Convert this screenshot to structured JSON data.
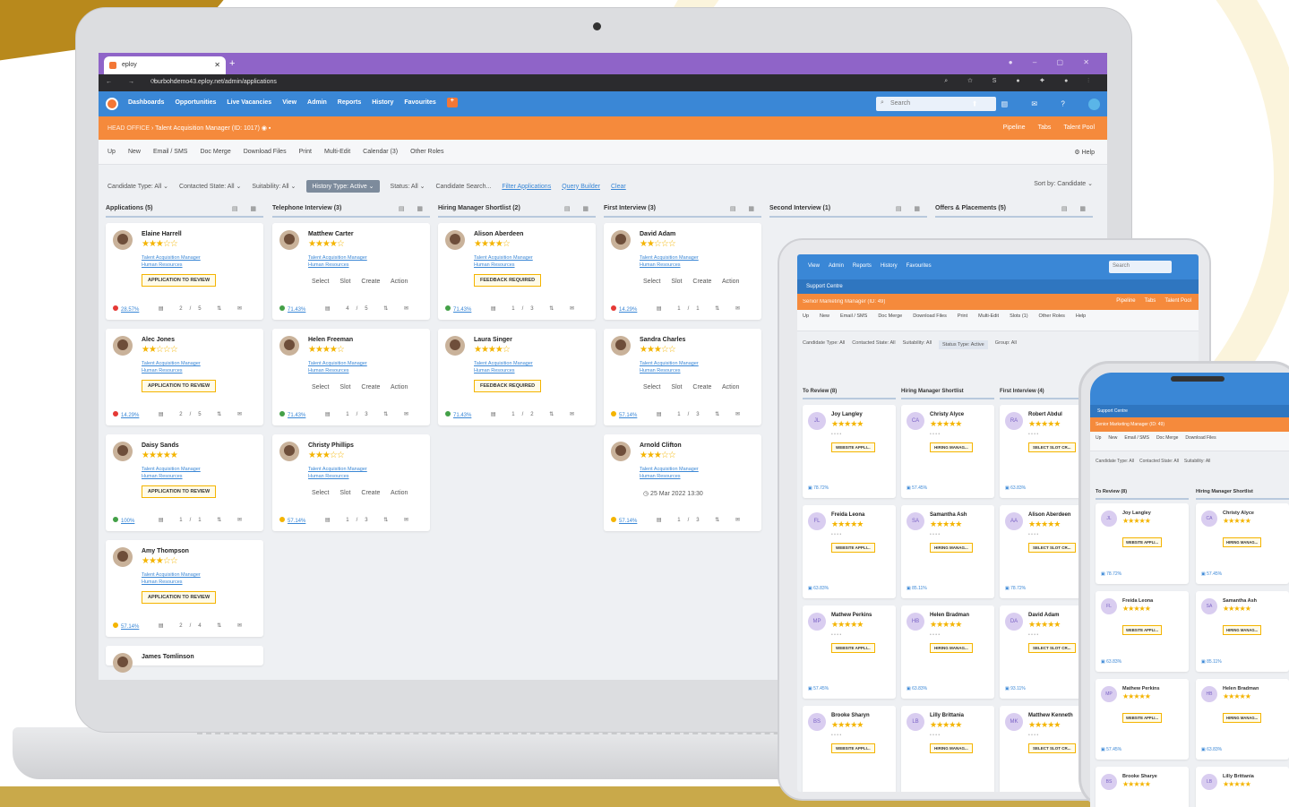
{
  "browser": {
    "tab_title": "eploy",
    "url": "burbohdemo43.eploy.net/admin/applications"
  },
  "nav": {
    "items": [
      "Dashboards",
      "Opportunities",
      "Live Vacancies",
      "View",
      "Admin",
      "Reports",
      "History",
      "Favourites"
    ],
    "search_placeholder": "Search"
  },
  "header": {
    "breadcrumb": "HEAD OFFICE",
    "title": "Talent Acquisition Manager (ID: 1017)",
    "right_items": [
      "Pipeline",
      "Tabs",
      "Talent Pool"
    ]
  },
  "toolbar": {
    "items": [
      "Up",
      "New",
      "Email / SMS",
      "Doc Merge",
      "Download Files",
      "Print",
      "Multi-Edit",
      "Calendar (3)",
      "Other Roles"
    ],
    "help": "Help"
  },
  "filters": {
    "items": [
      "Candidate Type: All",
      "Contacted State: All",
      "Suitability: All"
    ],
    "active": "History Type: Active",
    "status": "Status: All",
    "search_placeholder": "Candidate Search...",
    "links": [
      "Filter Applications",
      "Query Builder",
      "Clear"
    ],
    "sort": "Sort by: Candidate"
  },
  "columns": [
    {
      "title": "Applications (5)",
      "cards": [
        {
          "name": "Elaine Harrell",
          "stars": "★★★☆☆",
          "role": "Talent Acquisition Manager",
          "dept": "Human Resources",
          "action": "APPLICATION TO REVIEW",
          "dot": "#e53935",
          "pct": "28.57%",
          "count": "2/5"
        },
        {
          "name": "Alec Jones",
          "stars": "★★☆☆☆",
          "role": "Talent Acquisition Manager",
          "dept": "Human Resources",
          "action": "APPLICATION TO REVIEW",
          "dot": "#e53935",
          "pct": "14.29%",
          "count": "2/5"
        },
        {
          "name": "Daisy Sands",
          "stars": "★★★★★",
          "role": "Talent Acquisition Manager",
          "dept": "Human Resources",
          "action": "APPLICATION TO REVIEW",
          "dot": "#43a047",
          "pct": "100%",
          "count": "1/1"
        },
        {
          "name": "Amy Thompson",
          "stars": "★★★☆☆",
          "role": "Talent Acquisition Manager",
          "dept": "Human Resources",
          "action": "APPLICATION TO REVIEW",
          "dot": "#f4b400",
          "pct": "57.14%",
          "count": "2/4"
        }
      ],
      "extra": "James Tomlinson"
    },
    {
      "title": "Telephone Interview (3)",
      "cards": [
        {
          "name": "Matthew Carter",
          "stars": "★★★★☆",
          "role": "Talent Acquisition Manager",
          "dept": "Human Resources",
          "slot": "Select Slot   Create Action",
          "dot": "#43a047",
          "pct": "71.43%",
          "count": "4/5"
        },
        {
          "name": "Helen Freeman",
          "stars": "★★★★☆",
          "role": "Talent Acquisition Manager",
          "dept": "Human Resources",
          "slot": "Select Slot   Create Action",
          "dot": "#43a047",
          "pct": "71.43%",
          "count": "1/3"
        },
        {
          "name": "Christy Phillips",
          "stars": "★★★☆☆",
          "role": "Talent Acquisition Manager",
          "dept": "Human Resources",
          "slot": "Select Slot   Create Action",
          "dot": "#f4b400",
          "pct": "57.14%",
          "count": "1/3"
        }
      ]
    },
    {
      "title": "Hiring Manager Shortlist (2)",
      "cards": [
        {
          "name": "Alison Aberdeen",
          "stars": "★★★★☆",
          "role": "Talent Acquisition Manager",
          "dept": "Human Resources",
          "action": "FEEDBACK REQUIRED",
          "dot": "#43a047",
          "pct": "71.43%",
          "count": "1/3"
        },
        {
          "name": "Laura Singer",
          "stars": "★★★★☆",
          "role": "Talent Acquisition Manager",
          "dept": "Human Resources",
          "action": "FEEDBACK REQUIRED",
          "dot": "#43a047",
          "pct": "71.43%",
          "count": "1/2"
        }
      ]
    },
    {
      "title": "First Interview (3)",
      "cards": [
        {
          "name": "David Adam",
          "stars": "★★☆☆☆",
          "role": "Talent Acquisition Manager",
          "dept": "Human Resources",
          "slot": "Select Slot   Create Action",
          "dot": "#e53935",
          "pct": "14.29%",
          "count": "1/1"
        },
        {
          "name": "Sandra Charles",
          "stars": "★★★☆☆",
          "role": "Talent Acquisition Manager",
          "dept": "Human Resources",
          "slot": "Select Slot   Create Action",
          "dot": "#f4b400",
          "pct": "57.14%",
          "count": "1/3"
        },
        {
          "name": "Arnold Clifton",
          "stars": "★★★☆☆",
          "role": "Talent Acquisition Manager",
          "dept": "Human Resources",
          "date": "25 Mar 2022 13:30",
          "dot": "#f4b400",
          "pct": "57.14%",
          "count": "1/3"
        }
      ]
    },
    {
      "title": "Second Interview (1)",
      "cards": []
    },
    {
      "title": "Offers & Placements (5)",
      "cards": []
    }
  ],
  "tablet": {
    "nav_items": [
      "View",
      "Admin",
      "Reports",
      "History",
      "Favourites"
    ],
    "search": "Search",
    "sub": "Support Centre",
    "orange": "Senior Marketing Manager (ID: 49)",
    "orange_right": [
      "Pipeline",
      "Tabs",
      "Talent Pool"
    ],
    "toolbar": [
      "Up",
      "New",
      "Email / SMS",
      "Doc Merge",
      "Download Files",
      "Print",
      "Multi-Edit",
      "Slots (1)",
      "Other Roles",
      "Help"
    ],
    "filters": [
      "Candidate Type: All",
      "Contacted State: All",
      "Suitability: All",
      "Status Type: Active",
      "Group: All"
    ],
    "search_placeholder": "Candidate Search...",
    "columns": [
      {
        "title": "To Review (8)",
        "cards": [
          {
            "name": "Joy Langley",
            "initials": "JL",
            "btn": "WEBSITE APPLI...",
            "pct": "78.72%"
          },
          {
            "name": "Freida Leona",
            "initials": "FL",
            "btn": "WEBSITE APPLI...",
            "pct": "63.83%"
          },
          {
            "name": "Mathew Perkins",
            "initials": "MP",
            "btn": "WEBSITE APPLI...",
            "pct": "57.45%"
          },
          {
            "name": "Brooke Sharyn",
            "initials": "BS",
            "btn": "WEBSITE APPLI...",
            "pct": ""
          }
        ]
      },
      {
        "title": "Hiring Manager Shortlist",
        "cards": [
          {
            "name": "Christy Alyce",
            "initials": "CA",
            "btn": "HIRING MANAG...",
            "pct": "57.45%"
          },
          {
            "name": "Samantha Ash",
            "initials": "SA",
            "btn": "HIRING MANAG...",
            "pct": "85.11%"
          },
          {
            "name": "Helen Bradman",
            "initials": "HB",
            "btn": "HIRING MANAG...",
            "pct": "63.83%"
          },
          {
            "name": "Lilly Brittania",
            "initials": "LB",
            "btn": "HIRING MANAG...",
            "pct": ""
          }
        ]
      },
      {
        "title": "First Interview (4)",
        "cards": [
          {
            "name": "Robert Abdul",
            "initials": "RA",
            "btn": "SELECT SLOT   CR...",
            "pct": "63.83%"
          },
          {
            "name": "Alison Aberdeen",
            "initials": "AA",
            "btn": "SELECT SLOT   CR...",
            "pct": "78.72%"
          },
          {
            "name": "David Adam",
            "initials": "DA",
            "btn": "SELECT SLOT   CR...",
            "pct": "93.11%"
          },
          {
            "name": "Matthew Kenneth",
            "initials": "MK",
            "btn": "SELECT SLOT   CR...",
            "pct": ""
          }
        ]
      }
    ]
  },
  "phone": {
    "sub": "Support Centre",
    "orange": "Senior Marketing Manager (ID: 49)",
    "toolbar": [
      "Up",
      "New",
      "Email / SMS",
      "Doc Merge",
      "Download Files"
    ],
    "filters": [
      "Candidate Type: All",
      "Contacted State: All",
      "Suitability: All"
    ],
    "columns": [
      {
        "title": "To Review (8)",
        "cards": [
          {
            "name": "Joy Langley",
            "initials": "JL",
            "btn": "WEBSITE APPLI...",
            "pct": "78.72%"
          },
          {
            "name": "Freida Leona",
            "initials": "FL",
            "btn": "WEBSITE APPLI...",
            "pct": "63.83%"
          },
          {
            "name": "Mathew Perkins",
            "initials": "MP",
            "btn": "WEBSITE APPLI...",
            "pct": "57.45%"
          },
          {
            "name": "Brooke Sharye",
            "initials": "BS",
            "btn": "",
            "pct": ""
          }
        ]
      },
      {
        "title": "Hiring Manager Shortlist",
        "cards": [
          {
            "name": "Christy Alyce",
            "initials": "CA",
            "btn": "HIRING MANAG...",
            "pct": "57.45%"
          },
          {
            "name": "Samantha Ash",
            "initials": "SA",
            "btn": "HIRING MANAG...",
            "pct": "85.11%"
          },
          {
            "name": "Helen Bradman",
            "initials": "HB",
            "btn": "HIRING MANAG...",
            "pct": "63.83%"
          },
          {
            "name": "Lilly Brittania",
            "initials": "LB",
            "btn": "",
            "pct": ""
          }
        ]
      }
    ]
  }
}
